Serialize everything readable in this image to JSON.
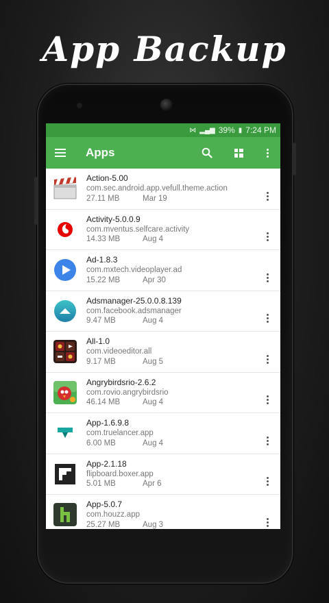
{
  "banner": {
    "title": "App Backup"
  },
  "status_bar": {
    "signal_text": "▕▏▒",
    "battery": "39%",
    "time": "7:24 PM"
  },
  "app_bar": {
    "title": "Apps"
  },
  "apps": [
    {
      "name": "Action-5.00",
      "package": "com.sec.android.app.vefull.theme.action",
      "size": "27.11 MB",
      "date": "Mar 19",
      "icon": "clapperboard-icon"
    },
    {
      "name": "Activity-5.0.0.9",
      "package": "com.mventus.selfcare.activity",
      "size": "14.33 MB",
      "date": "Aug 4",
      "icon": "vodafone-icon"
    },
    {
      "name": "Ad-1.8.3",
      "package": "com.mxtech.videoplayer.ad",
      "size": "15.22 MB",
      "date": "Apr 30",
      "icon": "play-icon"
    },
    {
      "name": "Adsmanager-25.0.0.8.139",
      "package": "com.facebook.adsmanager",
      "size": "9.47 MB",
      "date": "Aug 4",
      "icon": "adsmanager-icon"
    },
    {
      "name": "All-1.0",
      "package": "com.videoeditor.all",
      "size": "9.17 MB",
      "date": "Aug 5",
      "icon": "video-editor-icon"
    },
    {
      "name": "Angrybirdsrio-2.6.2",
      "package": "com.rovio.angrybirdsrio",
      "size": "46.14 MB",
      "date": "Aug 4",
      "icon": "angry-birds-icon"
    },
    {
      "name": "App-1.6.9.8",
      "package": "com.truelancer.app",
      "size": "6.00 MB",
      "date": "Aug 4",
      "icon": "truelancer-icon"
    },
    {
      "name": "App-2.1.18",
      "package": "flipboard.boxer.app",
      "size": "5.01 MB",
      "date": "Apr 6",
      "icon": "flipboard-icon"
    },
    {
      "name": "App-5.0.7",
      "package": "com.houzz.app",
      "size": "25.27 MB",
      "date": "Aug 3",
      "icon": "houzz-icon"
    }
  ],
  "colors": {
    "app_bar": "#4caf50",
    "status_bar": "#3a9b3e"
  }
}
